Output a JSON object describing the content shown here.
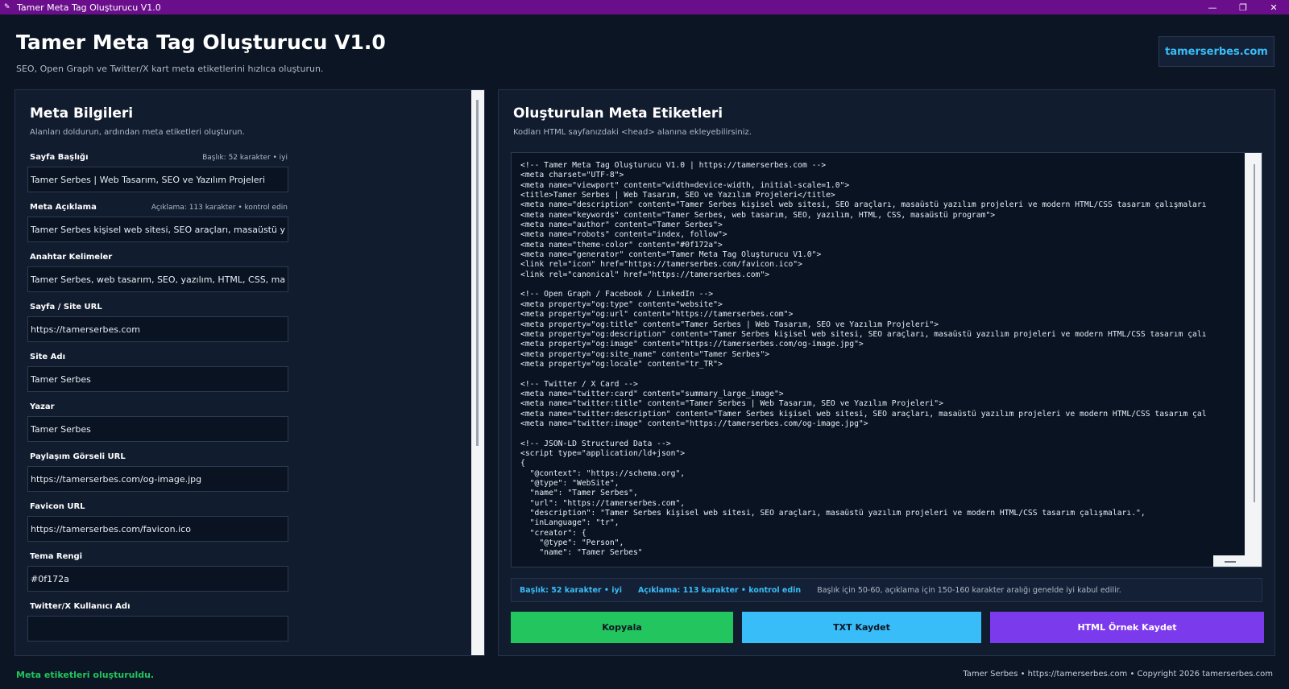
{
  "window": {
    "title": "Tamer Meta Tag Oluşturucu V1.0",
    "controls": {
      "minimize": "—",
      "maximize": "❐",
      "close": "✕"
    }
  },
  "header": {
    "title": "Tamer Meta Tag Oluşturucu V1.0",
    "subtitle": "SEO, Open Graph ve Twitter/X kart meta etiketlerini hızlıca oluşturun.",
    "site_button": "tamerserbes.com"
  },
  "form": {
    "title": "Meta Bilgileri",
    "hint": "Alanları doldurun, ardından meta etiketleri oluşturun.",
    "fields": [
      {
        "label": "Sayfa Başlığı",
        "status": "Başlık: 52 karakter • iyi",
        "value": "Tamer Serbes | Web Tasarım, SEO ve Yazılım Projeleri"
      },
      {
        "label": "Meta Açıklama",
        "status": "Açıklama: 113 karakter • kontrol edin",
        "value": "Tamer Serbes kişisel web sitesi, SEO araçları, masaüstü yazılım projeleri ve modern HTML/CSS tasarım çalışmaları."
      },
      {
        "label": "Anahtar Kelimeler",
        "status": "",
        "value": "Tamer Serbes, web tasarım, SEO, yazılım, HTML, CSS, masaüstü program"
      },
      {
        "label": "Sayfa / Site URL",
        "status": "",
        "value": "https://tamerserbes.com"
      },
      {
        "label": "Site Adı",
        "status": "",
        "value": "Tamer Serbes"
      },
      {
        "label": "Yazar",
        "status": "",
        "value": "Tamer Serbes"
      },
      {
        "label": "Paylaşım Görseli URL",
        "status": "",
        "value": "https://tamerserbes.com/og-image.jpg"
      },
      {
        "label": "Favicon URL",
        "status": "",
        "value": "https://tamerserbes.com/favicon.ico"
      },
      {
        "label": "Tema Rengi",
        "status": "",
        "value": "#0f172a"
      },
      {
        "label": "Twitter/X Kullanıcı Adı",
        "status": "",
        "value": ""
      }
    ]
  },
  "output": {
    "title": "Oluşturulan Meta Etiketleri",
    "hint": "Kodları HTML sayfanızdaki <head> alanına ekleyebilirsiniz.",
    "code_lines": [
      "<!-- Tamer Meta Tag Oluşturucu V1.0 | https://tamerserbes.com -->",
      "<meta charset=\"UTF-8\">",
      "<meta name=\"viewport\" content=\"width=device-width, initial-scale=1.0\">",
      "<title>Tamer Serbes | Web Tasarım, SEO ve Yazılım Projeleri</title>",
      "<meta name=\"description\" content=\"Tamer Serbes kişisel web sitesi, SEO araçları, masaüstü yazılım projeleri ve modern HTML/CSS tasarım çalışmaları",
      "<meta name=\"keywords\" content=\"Tamer Serbes, web tasarım, SEO, yazılım, HTML, CSS, masaüstü program\">",
      "<meta name=\"author\" content=\"Tamer Serbes\">",
      "<meta name=\"robots\" content=\"index, follow\">",
      "<meta name=\"theme-color\" content=\"#0f172a\">",
      "<meta name=\"generator\" content=\"Tamer Meta Tag Oluşturucu V1.0\">",
      "<link rel=\"icon\" href=\"https://tamerserbes.com/favicon.ico\">",
      "<link rel=\"canonical\" href=\"https://tamerserbes.com\">",
      "",
      "<!-- Open Graph / Facebook / LinkedIn -->",
      "<meta property=\"og:type\" content=\"website\">",
      "<meta property=\"og:url\" content=\"https://tamerserbes.com\">",
      "<meta property=\"og:title\" content=\"Tamer Serbes | Web Tasarım, SEO ve Yazılım Projeleri\">",
      "<meta property=\"og:description\" content=\"Tamer Serbes kişisel web sitesi, SEO araçları, masaüstü yazılım projeleri ve modern HTML/CSS tasarım çalı",
      "<meta property=\"og:image\" content=\"https://tamerserbes.com/og-image.jpg\">",
      "<meta property=\"og:site_name\" content=\"Tamer Serbes\">",
      "<meta property=\"og:locale\" content=\"tr_TR\">",
      "",
      "<!-- Twitter / X Card -->",
      "<meta name=\"twitter:card\" content=\"summary_large_image\">",
      "<meta name=\"twitter:title\" content=\"Tamer Serbes | Web Tasarım, SEO ve Yazılım Projeleri\">",
      "<meta name=\"twitter:description\" content=\"Tamer Serbes kişisel web sitesi, SEO araçları, masaüstü yazılım projeleri ve modern HTML/CSS tasarım çal",
      "<meta name=\"twitter:image\" content=\"https://tamerserbes.com/og-image.jpg\">",
      "",
      "<!-- JSON-LD Structured Data -->",
      "<script type=\"application/ld+json\">",
      "{",
      "  \"@context\": \"https://schema.org\",",
      "  \"@type\": \"WebSite\",",
      "  \"name\": \"Tamer Serbes\",",
      "  \"url\": \"https://tamerserbes.com\",",
      "  \"description\": \"Tamer Serbes kişisel web sitesi, SEO araçları, masaüstü yazılım projeleri ve modern HTML/CSS tasarım çalışmaları.\",",
      "  \"inLanguage\": \"tr\",",
      "  \"creator\": {",
      "    \"@type\": \"Person\",",
      "    \"name\": \"Tamer Serbes\""
    ],
    "stats": {
      "title_stat": "Başlık: 52 karakter • iyi",
      "desc_stat": "Açıklama: 113 karakter • kontrol edin",
      "tip": "Başlık için 50-60, açıklama için 150-160 karakter aralığı genelde iyi kabul edilir."
    },
    "buttons": {
      "copy": "Kopyala",
      "save_txt": "TXT Kaydet",
      "save_html": "HTML Örnek Kaydet"
    }
  },
  "statusbar": {
    "message": "Meta etiketleri oluşturuldu.",
    "footer": "Tamer Serbes • https://tamerserbes.com • Copyright 2026 tamerserbes.com"
  },
  "colors": {
    "titlebar": "#6a0e8c",
    "background": "#0c1524",
    "panel": "#111c2e",
    "accent": "#38bdf8",
    "success": "#22c55e",
    "purple": "#7c3aed"
  }
}
